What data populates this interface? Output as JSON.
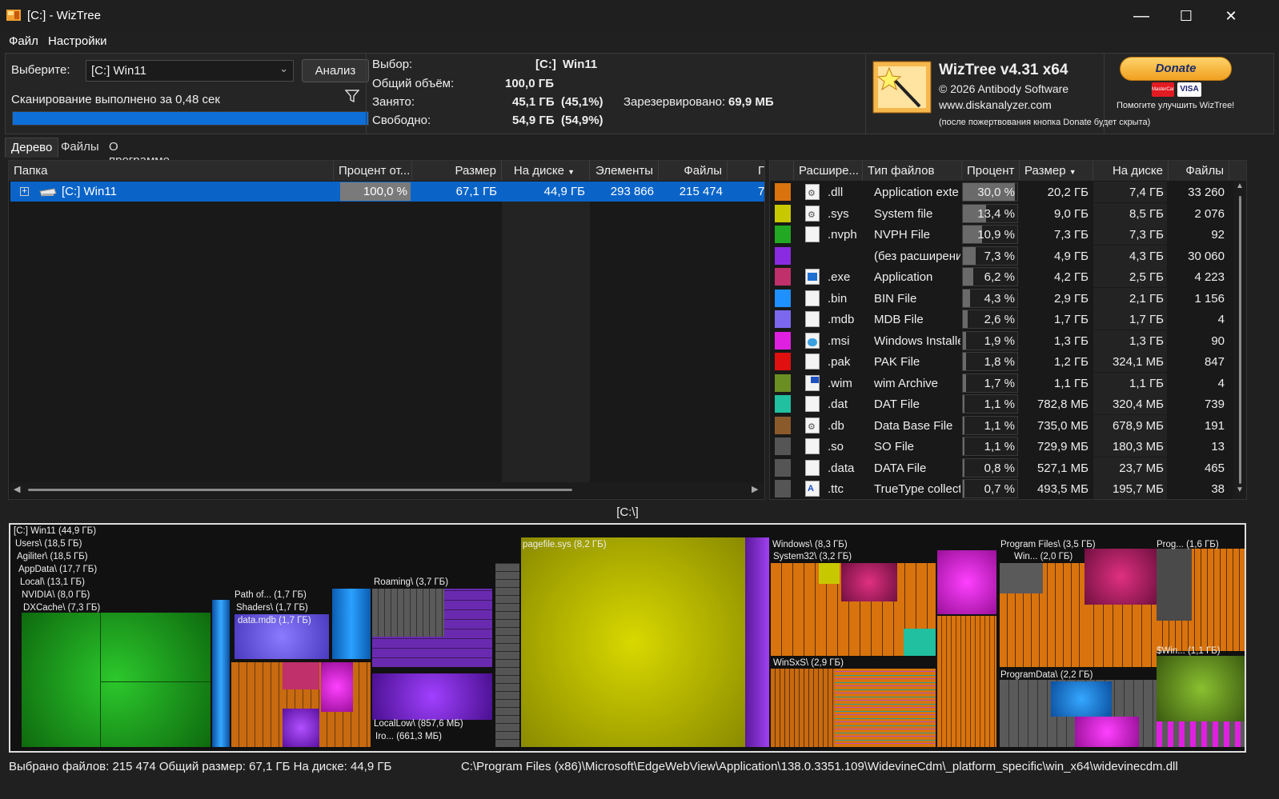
{
  "window": {
    "title": "[C:]  - WizTree",
    "minimize": "—",
    "maximize": "☐",
    "close": "✕"
  },
  "menu": [
    "Файл",
    "Настройки"
  ],
  "scan": {
    "select_label": "Выберите:",
    "drive": "[C:] Win11",
    "analyze": "Анализ",
    "status": "Сканирование выполнено за 0,48 сек",
    "progress": 1.0
  },
  "info": {
    "selection_label": "Выбор:",
    "selection_drive": "[C:]",
    "selection_name": "Win11",
    "total_label": "Общий объём:",
    "total": "100,0 ГБ",
    "used_label": "Занято:",
    "used": "45,1 ГБ",
    "used_pct": "(45,1%)",
    "free_label": "Свободно:",
    "free": "54,9 ГБ",
    "free_pct": "(54,9%)",
    "reserved_label": "Зарезервировано:",
    "reserved": "69,9 МБ"
  },
  "about": {
    "title": "WizTree v4.31 x64",
    "copyright": "© 2026 Antibody Software",
    "site": "www.diskanalyzer.com",
    "note": "(после пожертвования кнопка Donate будет скрыта)",
    "donate": "Donate",
    "help": "Помогите улучшить WizTree!",
    "card1": "MasterCard",
    "card2": "VISA"
  },
  "tabs": [
    "Дерево",
    "Файлы",
    "О программе"
  ],
  "tree": {
    "columns": [
      "Папка",
      "Процент от...",
      "Размер",
      "На диске",
      "Элементы",
      "Файлы",
      "Г"
    ],
    "row": {
      "name": "[C:] Win11",
      "percent": "100,0 %",
      "size": "67,1 ГБ",
      "disk": "44,9 ГБ",
      "items": "293 866",
      "files": "215 474",
      "extra": "7"
    }
  },
  "ext_columns": [
    "Расшире...",
    "Тип файлов",
    "Процент",
    "Размер",
    "На диске",
    "Файлы"
  ],
  "extensions": [
    {
      "color": "#d9730d",
      "ext": ".dll",
      "type": "Application exte",
      "pct": "30,0 %",
      "p": 0.3,
      "size": "20,2 ГБ",
      "disk": "7,4 ГБ",
      "files": "33 260",
      "icon": "gear-file-icon"
    },
    {
      "color": "#c8c800",
      "ext": ".sys",
      "type": "System file",
      "pct": "13,4 %",
      "p": 0.134,
      "size": "9,0 ГБ",
      "disk": "8,5 ГБ",
      "files": "2 076",
      "icon": "gear-file-icon"
    },
    {
      "color": "#22a822",
      "ext": ".nvph",
      "type": "NVPH File",
      "pct": "10,9 %",
      "p": 0.109,
      "size": "7,3 ГБ",
      "disk": "7,3 ГБ",
      "files": "92",
      "icon": "file-icon"
    },
    {
      "color": "#8a2be2",
      "ext": "",
      "type": "(без расширени",
      "pct": "7,3 %",
      "p": 0.073,
      "size": "4,9 ГБ",
      "disk": "4,3 ГБ",
      "files": "30 060",
      "icon": ""
    },
    {
      "color": "#c0306a",
      "ext": ".exe",
      "type": "Application",
      "pct": "6,2 %",
      "p": 0.062,
      "size": "4,2 ГБ",
      "disk": "2,5 ГБ",
      "files": "4 223",
      "icon": "exe-icon"
    },
    {
      "color": "#1e90ff",
      "ext": ".bin",
      "type": "BIN File",
      "pct": "4,3 %",
      "p": 0.043,
      "size": "2,9 ГБ",
      "disk": "2,1 ГБ",
      "files": "1 156",
      "icon": "file-icon"
    },
    {
      "color": "#7b68ee",
      "ext": ".mdb",
      "type": "MDB File",
      "pct": "2,6 %",
      "p": 0.026,
      "size": "1,7 ГБ",
      "disk": "1,7 ГБ",
      "files": "4",
      "icon": "file-icon"
    },
    {
      "color": "#e020e0",
      "ext": ".msi",
      "type": "Windows Installe",
      "pct": "1,9 %",
      "p": 0.019,
      "size": "1,3 ГБ",
      "disk": "1,3 ГБ",
      "files": "90",
      "icon": "installer-icon"
    },
    {
      "color": "#e01010",
      "ext": ".pak",
      "type": "PAK File",
      "pct": "1,8 %",
      "p": 0.018,
      "size": "1,2 ГБ",
      "disk": "324,1 МБ",
      "files": "847",
      "icon": "file-icon"
    },
    {
      "color": "#6b8e23",
      "ext": ".wim",
      "type": "wim Archive",
      "pct": "1,7 %",
      "p": 0.017,
      "size": "1,1 ГБ",
      "disk": "1,1 ГБ",
      "files": "4",
      "icon": "archive-icon"
    },
    {
      "color": "#20c0a0",
      "ext": ".dat",
      "type": "DAT File",
      "pct": "1,1 %",
      "p": 0.011,
      "size": "782,8 МБ",
      "disk": "320,4 МБ",
      "files": "739",
      "icon": "file-icon"
    },
    {
      "color": "#8b5a2b",
      "ext": ".db",
      "type": "Data Base File",
      "pct": "1,1 %",
      "p": 0.011,
      "size": "735,0 МБ",
      "disk": "678,9 МБ",
      "files": "191",
      "icon": "gear-file-icon"
    },
    {
      "color": "#555555",
      "ext": ".so",
      "type": "SO File",
      "pct": "1,1 %",
      "p": 0.011,
      "size": "729,9 МБ",
      "disk": "180,3 МБ",
      "files": "13",
      "icon": "file-icon"
    },
    {
      "color": "#555555",
      "ext": ".data",
      "type": "DATA File",
      "pct": "0,8 %",
      "p": 0.008,
      "size": "527,1 МБ",
      "disk": "23,7 МБ",
      "files": "465",
      "icon": "file-icon"
    },
    {
      "color": "#555555",
      "ext": ".ttc",
      "type": "TrueType collect",
      "pct": "0,7 %",
      "p": 0.007,
      "size": "493,5 МБ",
      "disk": "195,7 МБ",
      "files": "38",
      "icon": "font-file-icon"
    }
  ],
  "treemap": {
    "caption": "[C:\\]",
    "labels": {
      "root": "[C:] Win11  (44,9 ГБ)",
      "users": "Users\\ (18,5 ГБ)",
      "agiliter": "Agiliter\\ (18,5 ГБ)",
      "appdata": "AppData\\ (17,7 ГБ)",
      "local": "Local\\ (13,1 ГБ)",
      "nvidia": "NVIDIA\\ (8,0 ГБ)",
      "dxcache": "DXCache\\ (7,3 ГБ)",
      "pathof": "Path of... (1,7 ГБ)",
      "shaders": "Shaders\\ (1,7 ГБ)",
      "datamdb": "data.mdb (1,7 ГБ)",
      "roaming": "Roaming\\ (3,7 ГБ)",
      "locallow": "LocalLow\\ (857,6 МБ)",
      "iro": "Iro... (661,3 МБ)",
      "pagefile": "pagefile.sys (8,2 ГБ)",
      "windows": "Windows\\ (8,3 ГБ)",
      "system32": "System32\\ (3,2 ГБ)",
      "winsxs": "WinSxS\\ (2,9 ГБ)",
      "progfiles": "Program Files\\ (3,5 ГБ)",
      "win": "Win... (2,0 ГБ)",
      "progdata": "ProgramData\\ (2,2 ГБ)",
      "prog": "Prog... (1,6 ГБ)",
      "swin": "$Win... (1,1 ГБ)"
    }
  },
  "status": {
    "selected": "Выбрано файлов: 215 474  Общий размер: 67,1 ГБ  На диске: 44,9 ГБ",
    "path": "C:\\Program Files (x86)\\Microsoft\\EdgeWebView\\Application\\138.0.3351.109\\WidevineCdm\\_platform_specific\\win_x64\\widevinecdm.dll"
  }
}
